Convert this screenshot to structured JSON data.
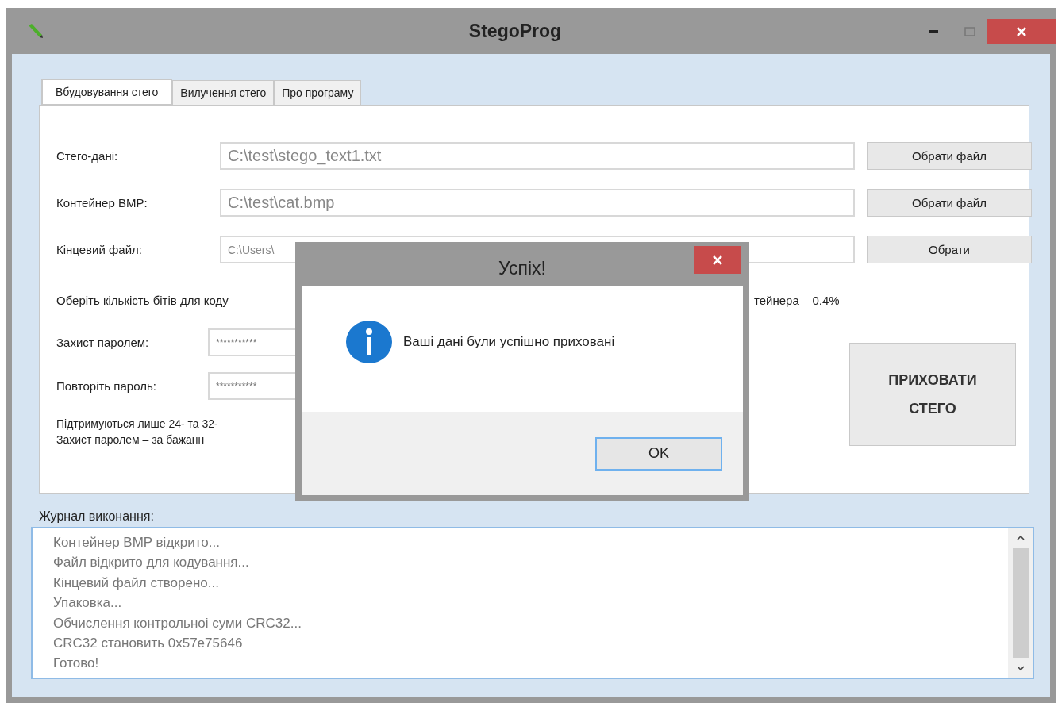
{
  "window": {
    "title": "StegoProg"
  },
  "tabs": [
    {
      "label": "Вбудовування стего",
      "selected": true
    },
    {
      "label": "Вилучення стего",
      "selected": false
    },
    {
      "label": "Про програму",
      "selected": false
    }
  ],
  "fields": [
    {
      "label": "Стего-дані:",
      "value": "C:\\test\\stego_text1.txt",
      "button": "Обрати файл",
      "kind": "large"
    },
    {
      "label": "Контейнер BMP:",
      "value": "C:\\test\\cat.bmp",
      "button": "Обрати файл",
      "kind": "large"
    },
    {
      "label": "Кінцевий файл:",
      "value": "C:\\Users\\",
      "button": "Обрати",
      "kind": "small"
    }
  ],
  "bits_note": {
    "start": "Оберіть кількість бітів для коду",
    "end": "тейнера – 0.4%"
  },
  "passwords": [
    {
      "label": "Захист паролем:",
      "value": "***********"
    },
    {
      "label": "Повторіть пароль:",
      "value": "***********"
    }
  ],
  "notes": [
    "Підтримуються лише 24- та 32-",
    "Захист паролем – за бажанн"
  ],
  "hide_button": "ПРИХОВАТИ СТЕГО",
  "log": {
    "label": "Журнал виконання:",
    "lines": [
      "Контейнер BMP відкрито...",
      "Файл відкрито для кодування...",
      "Кінцевий файл створено...",
      "Упаковка...",
      "Обчислення контрольноі суми CRC32...",
      "CRC32 становить 0x57e75646",
      "Готово!"
    ]
  },
  "dialog": {
    "title": "Успіх!",
    "message": "Ваші дані були успішно приховані",
    "button": "OK"
  }
}
